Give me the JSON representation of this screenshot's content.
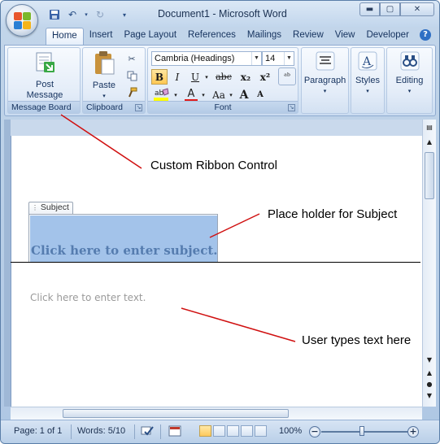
{
  "window": {
    "title": "Document1 - Microsoft Word"
  },
  "tabs": [
    "Home",
    "Insert",
    "Page Layout",
    "References",
    "Mailings",
    "Review",
    "View",
    "Developer"
  ],
  "ribbon": {
    "message_board": {
      "button_label_1": "Post",
      "button_label_2": "Message",
      "group_label": "Message Board"
    },
    "clipboard": {
      "paste_label": "Paste",
      "group_label": "Clipboard"
    },
    "font": {
      "font_name": "Cambria (Headings)",
      "font_size": "14",
      "group_label": "Font",
      "bold": "B",
      "italic": "I",
      "underline": "U",
      "strike": "abc",
      "subscript": "x₂",
      "superscript": "x²",
      "font_color": "A",
      "change_case": "Aa",
      "grow": "A",
      "shrink": "A"
    },
    "paragraph": {
      "label": "Paragraph"
    },
    "styles": {
      "label": "Styles"
    },
    "editing": {
      "label": "Editing"
    }
  },
  "document": {
    "subject_tag": "Subject",
    "subject_placeholder": "Click here to enter subject.",
    "body_placeholder": "Click here to enter text."
  },
  "annotations": {
    "ribbon": "Custom Ribbon Control",
    "subject": "Place holder for Subject",
    "body": "User types text here"
  },
  "status": {
    "page": "Page: 1 of 1",
    "words": "Words: 5/10",
    "zoom": "100%"
  },
  "colors": {
    "annotation_line": "#d01010",
    "subject_fill": "#a3c3ea",
    "ribbon_bg": "#dde9f7"
  },
  "icons": [
    "office-button-icon",
    "save-icon",
    "undo-icon",
    "redo-icon",
    "customize-qat-icon",
    "help-icon",
    "post-message-icon",
    "paste-icon",
    "cut-icon",
    "copy-icon",
    "format-painter-icon",
    "paragraph-icon",
    "styles-icon",
    "editing-icon"
  ]
}
